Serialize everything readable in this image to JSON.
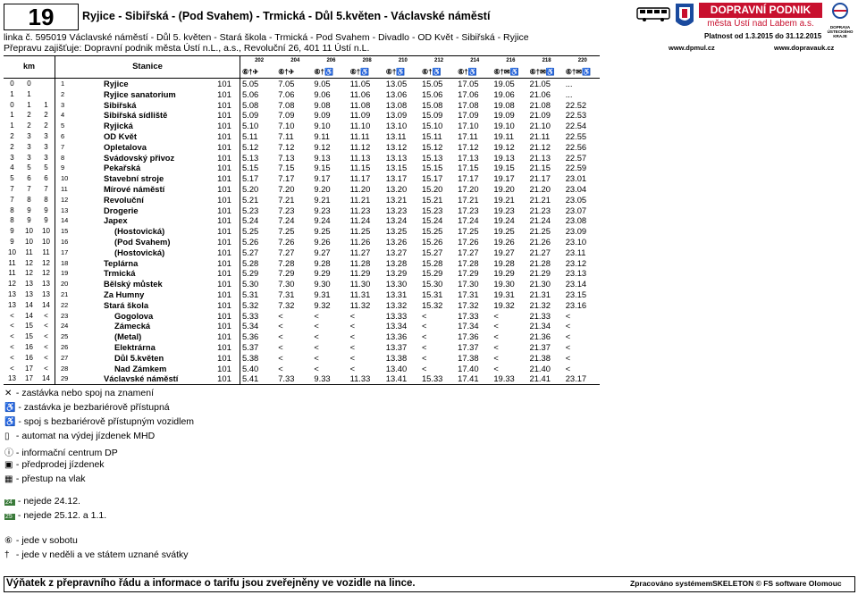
{
  "header": {
    "line_number": "19",
    "route_title": "Ryjice - Sibiřská -    (Pod Svahem) - Trmická -  Důl 5.květen - Václavské náměstí",
    "line_info": "linka č. 595019 Václavské náměstí - Důl 5. květen - Stará škola - Trmická - Pod Svahem - Divadlo - OD Květ - Sibiřská - Ryjice",
    "operator": "Přepravu zajišťuje: Dopravní podnik města Ústí n.L., a.s., Revoluční 26, 401 11 Ústí n.L.",
    "validity": "Platnost od 1.3.2015 do 31.12.2015",
    "web_dp": "www.dpmul.cz",
    "web_ok": "www.dopravauk.cz",
    "logo_line1": "DOPRAVNÍ PODNIK",
    "logo_line2": "města Ústí nad Labem a.s.",
    "logo_ok": "DOPRAVA ÚSTECKÉHO KRAJE"
  },
  "columns": {
    "km": "km",
    "stanice": "Stanice",
    "trips": [
      "202",
      "204",
      "206",
      "208",
      "210",
      "212",
      "214",
      "216",
      "218",
      "220"
    ],
    "trip_marks": [
      "⑥†✈",
      "⑥†✈",
      "⑥†♿",
      "⑥†♿",
      "⑥†♿",
      "⑥†♿",
      "⑥†♿",
      "⑥†✉♿",
      "⑥†✉♿",
      "⑥†✉♿"
    ]
  },
  "rows": [
    {
      "km": [
        "0",
        "0",
        ""
      ],
      "idx": "1",
      "name": "Ryjice",
      "zone": "101",
      "t": [
        "5.05",
        "7.05",
        "9.05",
        "11.05",
        "13.05",
        "15.05",
        "17.05",
        "19.05",
        "21.05",
        "..."
      ]
    },
    {
      "km": [
        "1",
        "1",
        ""
      ],
      "idx": "2",
      "name": "Ryjice sanatorium",
      "zone": "101",
      "t": [
        "5.06",
        "7.06",
        "9.06",
        "11.06",
        "13.06",
        "15.06",
        "17.06",
        "19.06",
        "21.06",
        "..."
      ]
    },
    {
      "km": [
        "0",
        "1",
        "1"
      ],
      "idx": "3",
      "name": "Sibiřská",
      "zone": "101",
      "t": [
        "5.08",
        "7.08",
        "9.08",
        "11.08",
        "13.08",
        "15.08",
        "17.08",
        "19.08",
        "21.08",
        "22.52"
      ]
    },
    {
      "km": [
        "1",
        "2",
        "2"
      ],
      "idx": "4",
      "name": "Sibiřská sídliště",
      "zone": "101",
      "t": [
        "5.09",
        "7.09",
        "9.09",
        "11.09",
        "13.09",
        "15.09",
        "17.09",
        "19.09",
        "21.09",
        "22.53"
      ]
    },
    {
      "km": [
        "1",
        "2",
        "2"
      ],
      "idx": "5",
      "name": "Ryjická",
      "zone": "101",
      "t": [
        "5.10",
        "7.10",
        "9.10",
        "11.10",
        "13.10",
        "15.10",
        "17.10",
        "19.10",
        "21.10",
        "22.54"
      ]
    },
    {
      "km": [
        "2",
        "3",
        "3"
      ],
      "idx": "6",
      "name": "OD Květ",
      "zone": "101",
      "t": [
        "5.11",
        "7.11",
        "9.11",
        "11.11",
        "13.11",
        "15.11",
        "17.11",
        "19.11",
        "21.11",
        "22.55"
      ]
    },
    {
      "km": [
        "2",
        "3",
        "3"
      ],
      "idx": "7",
      "name": "Opletalova",
      "zone": "101",
      "t": [
        "5.12",
        "7.12",
        "9.12",
        "11.12",
        "13.12",
        "15.12",
        "17.12",
        "19.12",
        "21.12",
        "22.56"
      ]
    },
    {
      "km": [
        "3",
        "3",
        "3"
      ],
      "idx": "8",
      "name": "Svádovský přivoz",
      "zone": "101",
      "t": [
        "5.13",
        "7.13",
        "9.13",
        "11.13",
        "13.13",
        "15.13",
        "17.13",
        "19.13",
        "21.13",
        "22.57"
      ]
    },
    {
      "km": [
        "4",
        "5",
        "5"
      ],
      "idx": "9",
      "name": "Pekařská",
      "zone": "101",
      "t": [
        "5.15",
        "7.15",
        "9.15",
        "11.15",
        "13.15",
        "15.15",
        "17.15",
        "19.15",
        "21.15",
        "22.59"
      ]
    },
    {
      "km": [
        "5",
        "6",
        "6"
      ],
      "idx": "10",
      "name": "Stavební stroje",
      "zone": "101",
      "t": [
        "5.17",
        "7.17",
        "9.17",
        "11.17",
        "13.17",
        "15.17",
        "17.17",
        "19.17",
        "21.17",
        "23.01"
      ]
    },
    {
      "km": [
        "7",
        "7",
        "7"
      ],
      "idx": "11",
      "name": "Mírové náměstí",
      "zone": "101",
      "t": [
        "5.20",
        "7.20",
        "9.20",
        "11.20",
        "13.20",
        "15.20",
        "17.20",
        "19.20",
        "21.20",
        "23.04"
      ]
    },
    {
      "km": [
        "7",
        "8",
        "8"
      ],
      "idx": "12",
      "name": "Revoluční",
      "zone": "101",
      "t": [
        "5.21",
        "7.21",
        "9.21",
        "11.21",
        "13.21",
        "15.21",
        "17.21",
        "19.21",
        "21.21",
        "23.05"
      ]
    },
    {
      "km": [
        "8",
        "9",
        "9"
      ],
      "idx": "13",
      "name": "Drogerie",
      "zone": "101",
      "t": [
        "5.23",
        "7.23",
        "9.23",
        "11.23",
        "13.23",
        "15.23",
        "17.23",
        "19.23",
        "21.23",
        "23.07"
      ]
    },
    {
      "km": [
        "8",
        "9",
        "9"
      ],
      "idx": "14",
      "name": "Japex",
      "zone": "101",
      "t": [
        "5.24",
        "7.24",
        "9.24",
        "11.24",
        "13.24",
        "15.24",
        "17.24",
        "19.24",
        "21.24",
        "23.08"
      ]
    },
    {
      "km": [
        "9",
        "10",
        "10"
      ],
      "idx": "15",
      "name": "(Hostovická)",
      "zone": "101",
      "t": [
        "5.25",
        "7.25",
        "9.25",
        "11.25",
        "13.25",
        "15.25",
        "17.25",
        "19.25",
        "21.25",
        "23.09"
      ]
    },
    {
      "km": [
        "9",
        "10",
        "10"
      ],
      "idx": "16",
      "name": "(Pod Svahem)",
      "zone": "101",
      "t": [
        "5.26",
        "7.26",
        "9.26",
        "11.26",
        "13.26",
        "15.26",
        "17.26",
        "19.26",
        "21.26",
        "23.10"
      ]
    },
    {
      "km": [
        "10",
        "11",
        "11"
      ],
      "idx": "17",
      "name": "(Hostovická)",
      "zone": "101",
      "t": [
        "5.27",
        "7.27",
        "9.27",
        "11.27",
        "13.27",
        "15.27",
        "17.27",
        "19.27",
        "21.27",
        "23.11"
      ]
    },
    {
      "km": [
        "11",
        "12",
        "12"
      ],
      "idx": "18",
      "name": "Teplárna",
      "zone": "101",
      "t": [
        "5.28",
        "7.28",
        "9.28",
        "11.28",
        "13.28",
        "15.28",
        "17.28",
        "19.28",
        "21.28",
        "23.12"
      ]
    },
    {
      "km": [
        "11",
        "12",
        "12"
      ],
      "idx": "19",
      "name": "Trmická",
      "zone": "101",
      "t": [
        "5.29",
        "7.29",
        "9.29",
        "11.29",
        "13.29",
        "15.29",
        "17.29",
        "19.29",
        "21.29",
        "23.13"
      ]
    },
    {
      "km": [
        "12",
        "13",
        "13"
      ],
      "idx": "20",
      "name": "Bělský můstek",
      "zone": "101",
      "t": [
        "5.30",
        "7.30",
        "9.30",
        "11.30",
        "13.30",
        "15.30",
        "17.30",
        "19.30",
        "21.30",
        "23.14"
      ]
    },
    {
      "km": [
        "13",
        "13",
        "13"
      ],
      "idx": "21",
      "name": "Za Humny",
      "zone": "101",
      "t": [
        "5.31",
        "7.31",
        "9.31",
        "11.31",
        "13.31",
        "15.31",
        "17.31",
        "19.31",
        "21.31",
        "23.15"
      ]
    },
    {
      "km": [
        "13",
        "14",
        "14"
      ],
      "idx": "22",
      "name": "Stará škola",
      "zone": "101",
      "t": [
        "5.32",
        "7.32",
        "9.32",
        "11.32",
        "13.32",
        "15.32",
        "17.32",
        "19.32",
        "21.32",
        "23.16"
      ]
    },
    {
      "km": [
        "<",
        "14",
        "<"
      ],
      "idx": "23",
      "name": "Gogolova",
      "zone": "101",
      "t": [
        "5.33",
        "<",
        "<",
        "<",
        "13.33",
        "<",
        "17.33",
        "<",
        "21.33",
        "<"
      ]
    },
    {
      "km": [
        "<",
        "15",
        "<"
      ],
      "idx": "24",
      "name": "Zámecká",
      "zone": "101",
      "t": [
        "5.34",
        "<",
        "<",
        "<",
        "13.34",
        "<",
        "17.34",
        "<",
        "21.34",
        "<"
      ]
    },
    {
      "km": [
        "<",
        "15",
        "<"
      ],
      "idx": "25",
      "name": "(Metal)",
      "zone": "101",
      "t": [
        "5.36",
        "<",
        "<",
        "<",
        "13.36",
        "<",
        "17.36",
        "<",
        "21.36",
        "<"
      ]
    },
    {
      "km": [
        "<",
        "16",
        "<"
      ],
      "idx": "26",
      "name": "Elektrárna",
      "zone": "101",
      "t": [
        "5.37",
        "<",
        "<",
        "<",
        "13.37",
        "<",
        "17.37",
        "<",
        "21.37",
        "<"
      ]
    },
    {
      "km": [
        "<",
        "16",
        "<"
      ],
      "idx": "27",
      "name": "Důl 5.květen",
      "zone": "101",
      "t": [
        "5.38",
        "<",
        "<",
        "<",
        "13.38",
        "<",
        "17.38",
        "<",
        "21.38",
        "<"
      ]
    },
    {
      "km": [
        "<",
        "17",
        "<"
      ],
      "idx": "28",
      "name": "Nad Zámkem",
      "zone": "101",
      "t": [
        "5.40",
        "<",
        "<",
        "<",
        "13.40",
        "<",
        "17.40",
        "<",
        "21.40",
        "<"
      ]
    },
    {
      "km": [
        "13",
        "17",
        "14"
      ],
      "idx": "29",
      "name": "Václavské náměstí",
      "zone": "101",
      "t": [
        "5.41",
        "7.33",
        "9.33",
        "11.33",
        "13.41",
        "15.33",
        "17.41",
        "19.33",
        "21.41",
        "23.17"
      ]
    }
  ],
  "legend": [
    {
      "sym": "✕",
      "text": " - zastávka nebo spoj na znamení"
    },
    {
      "sym": "♿",
      "text": " - zastávka je bezbariérově přístupná"
    },
    {
      "sym": "♿",
      "text": " - spoj s bezbariérově přístupným vozidlem"
    },
    {
      "sym": "▯",
      "text": " - automat na výdej jízdenek MHD"
    },
    {
      "sym": "ⓘ",
      "text": " - informační centrum DP"
    },
    {
      "sym": "▣",
      "text": " - předprodej jízdenek"
    },
    {
      "sym": "▦",
      "text": " - přestup na vlak"
    }
  ],
  "legend2": [
    {
      "sym": "24",
      "text": " - nejede 24.12."
    },
    {
      "sym": "25",
      "text": " - nejede 25.12. a 1.1."
    }
  ],
  "legend3": [
    {
      "sym": "⑥",
      "text": " - jede v sobotu"
    },
    {
      "sym": "†",
      "text": " - jede v neděli a ve státem uznané svátky"
    }
  ],
  "footer": {
    "notice": "Výňatek z přepravního řádu a informace o tarifu jsou zveřejněny ve vozidle na lince.",
    "software": "Zpracováno systémemSKELETON © FS software Olomouc"
  }
}
